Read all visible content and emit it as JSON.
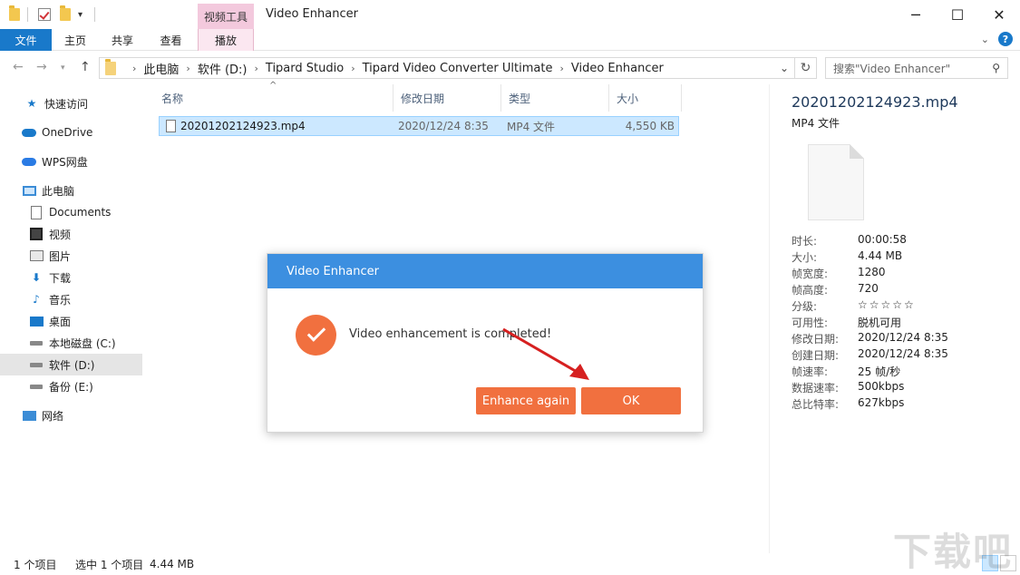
{
  "window": {
    "title": "Video Enhancer",
    "tool_tab": "视频工具",
    "minimize_glyph": "─",
    "maximize_glyph": "☐",
    "close_glyph": "✕"
  },
  "ribbon": {
    "tabs": [
      "文件",
      "主页",
      "共享",
      "查看",
      "播放"
    ]
  },
  "address": {
    "breadcrumbs": [
      "此电脑",
      "软件 (D:)",
      "Tipard Studio",
      "Tipard Video Converter Ultimate",
      "Video Enhancer"
    ],
    "search_placeholder": "搜索\"Video Enhancer\""
  },
  "nav": {
    "items": [
      {
        "label": "快速访问",
        "icon": "star-icon"
      },
      {
        "label": "OneDrive",
        "icon": "cloud-icon"
      },
      {
        "label": "WPS网盘",
        "icon": "cloud-icon"
      },
      {
        "label": "此电脑",
        "icon": "computer-icon"
      },
      {
        "label": "Documents",
        "icon": "document-icon"
      },
      {
        "label": "视频",
        "icon": "video-icon"
      },
      {
        "label": "图片",
        "icon": "picture-icon"
      },
      {
        "label": "下载",
        "icon": "download-icon"
      },
      {
        "label": "音乐",
        "icon": "music-icon"
      },
      {
        "label": "桌面",
        "icon": "desktop-icon"
      },
      {
        "label": "本地磁盘 (C:)",
        "icon": "drive-icon"
      },
      {
        "label": "软件 (D:)",
        "icon": "drive-icon"
      },
      {
        "label": "备份 (E:)",
        "icon": "drive-icon"
      },
      {
        "label": "网络",
        "icon": "network-icon"
      }
    ]
  },
  "filelist": {
    "columns": [
      "名称",
      "修改日期",
      "类型",
      "大小"
    ],
    "rows": [
      {
        "name": "20201202124923.mp4",
        "modified": "2020/12/24 8:35",
        "type": "MP4 文件",
        "size": "4,550 KB"
      }
    ]
  },
  "details": {
    "filename": "20201202124923.mp4",
    "filetype": "MP4 文件",
    "props": [
      {
        "k": "时长:",
        "v": "00:00:58"
      },
      {
        "k": "大小:",
        "v": "4.44 MB"
      },
      {
        "k": "帧宽度:",
        "v": "1280"
      },
      {
        "k": "帧高度:",
        "v": "720"
      },
      {
        "k": "分级:",
        "v": "☆☆☆☆☆"
      },
      {
        "k": "可用性:",
        "v": "脱机可用"
      },
      {
        "k": "修改日期:",
        "v": "2020/12/24 8:35"
      },
      {
        "k": "创建日期:",
        "v": "2020/12/24 8:35"
      },
      {
        "k": "帧速率:",
        "v": "25 帧/秒"
      },
      {
        "k": "数据速率:",
        "v": "500kbps"
      },
      {
        "k": "总比特率:",
        "v": "627kbps"
      }
    ]
  },
  "status": {
    "count": "1 个项目",
    "selected": "选中 1 个项目",
    "size": "4.44 MB"
  },
  "dialog": {
    "title": "Video Enhancer",
    "message": "Video enhancement is completed!",
    "enhance_again": "Enhance again",
    "ok": "OK"
  },
  "colors": {
    "accent": "#1979ca",
    "dialog_header": "#3c8fe0",
    "orange": "#f1703f",
    "selection": "#cce8ff"
  }
}
